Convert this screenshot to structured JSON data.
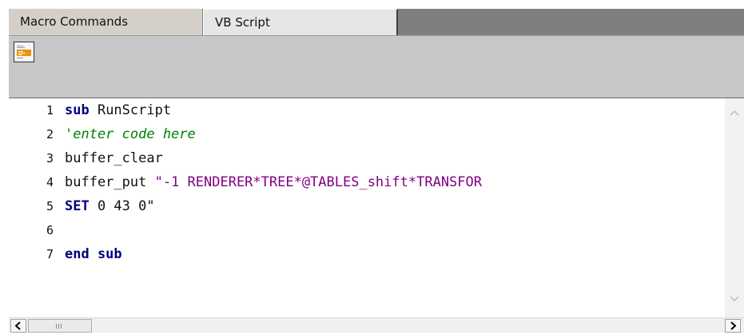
{
  "tabs": [
    {
      "label": "Macro Commands",
      "active": false
    },
    {
      "label": "VB Script",
      "active": true
    }
  ],
  "toolbar": {
    "script_button_icon": "script-editor-icon"
  },
  "editor": {
    "lines": [
      {
        "number": "1",
        "keyword": "sub",
        "text": " RunScript"
      },
      {
        "number": "2",
        "comment": "'enter code here"
      },
      {
        "number": "3",
        "text": "buffer_clear"
      },
      {
        "number": "4",
        "text": "buffer_put ",
        "string": "\"-1 RENDERER*TREE*@TABLES_shift*TRANSFOR"
      },
      {
        "number": "5",
        "keyword": "SET",
        "text": " 0 43 0\""
      },
      {
        "number": "6",
        "text": ""
      },
      {
        "number": "7",
        "keyword": "end sub",
        "text": ""
      }
    ]
  },
  "scrollbar": {
    "left_arrow": "<",
    "right_arrow": ">",
    "thumb_grip": "III"
  },
  "colors": {
    "keyword": "#000080",
    "comment": "#008000",
    "string": "#800080"
  }
}
